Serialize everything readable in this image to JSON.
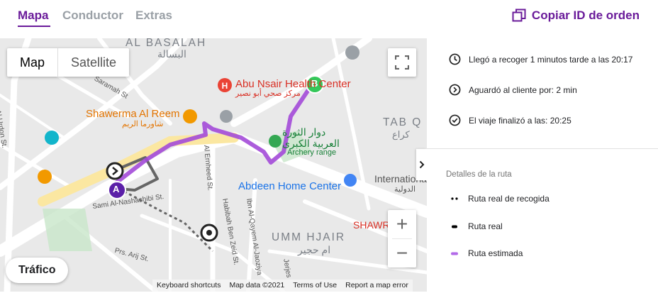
{
  "tabs": [
    {
      "label": "Mapa",
      "active": true
    },
    {
      "label": "Conductor",
      "active": false
    },
    {
      "label": "Extras",
      "active": false
    }
  ],
  "copy_button": {
    "label": "Copiar ID de orden",
    "icon": "copy-icon"
  },
  "map": {
    "map_type": {
      "map": "Map",
      "satellite": "Satellite"
    },
    "traffic_label": "Tráfico",
    "zoom_in": "+",
    "zoom_out": "−",
    "attribution": {
      "shortcuts": "Keyboard shortcuts",
      "data": "Map data ©2021",
      "terms": "Terms of Use",
      "report": "Report a map error"
    },
    "labels": {
      "al_basalah": "AL BASALAH",
      "al_basalah_ar": "البسالة",
      "abu_nsair": "Abu Nsair Health Center",
      "abu_nsair_ar": "مركز صحي أبو نصير",
      "shawerma": "Shawerma Al Reem",
      "shawerma_ar": "شاورما الريم",
      "dawar": "دوار الثورة",
      "dawar2": "العربية الكبرى",
      "archery": "Archery range",
      "abdeen": "Abdeen Home Center",
      "international": "International",
      "international_ar": "الدولية",
      "tab_kraa": "TAB Q",
      "tab_kraa_ar": "كراع",
      "umm_hjair": "UMM HJAIR",
      "umm_hjair_ar": "ام حجير",
      "shawr": "SHAWR",
      "al_urdon": "Al-Urdon St.",
      "saramah": "Saramah St",
      "ernheed": "Al Ernheed St.",
      "habibah": "Habibah Ben Zeid St.",
      "ibn_al_qayem": "Ibn Al-Qayem Al-Jaoziya",
      "arij": "Prs. Arij St.",
      "jerjes": "Jerjes",
      "sami": "Sami Al-Nashashibi St."
    },
    "markers": {
      "start": "A",
      "end": "B"
    },
    "colors": {
      "route_estimated": "#a34ad8",
      "route_real": "#555555",
      "marker_a": "#5b1fa8",
      "marker_b": "#34c759"
    }
  },
  "panel": {
    "events": [
      {
        "icon": "clock-icon",
        "text": "Llegó a recoger 1 minutos tarde a las 20:17"
      },
      {
        "icon": "chevron-circle-icon",
        "text": "Aguardó al cliente por: 2 min"
      },
      {
        "icon": "check-circle-icon",
        "text": "El viaje finalizó a las: 20:25"
      }
    ],
    "route_details_title": "Detalles de la ruta",
    "legend": [
      {
        "text": "Ruta real de recogida",
        "swatch": "dots"
      },
      {
        "text": "Ruta real",
        "swatch": "black-dash"
      },
      {
        "text": "Ruta estimada",
        "swatch": "purple-dash"
      }
    ]
  }
}
